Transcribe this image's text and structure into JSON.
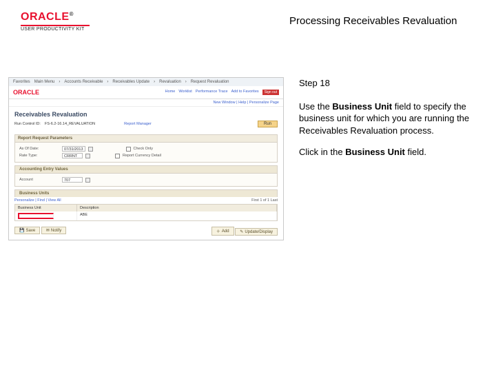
{
  "header": {
    "brand": "ORACLE",
    "subbrand": "USER PRODUCTIVITY KIT",
    "page_title": "Processing Receivables Revaluation"
  },
  "instructions": {
    "step_label": "Step 18",
    "p1_a": "Use the ",
    "p1_b": "Business Unit",
    "p1_c": " field to specify the business unit for which you are running the Receivables Revaluation process.",
    "p2_a": "Click in the ",
    "p2_b": "Business Unit",
    "p2_c": " field."
  },
  "app": {
    "breadcrumb": [
      "Favorites",
      "Main Menu",
      "Accounts Receivable",
      "Receivables Update",
      "Revaluation",
      "Request Revaluation"
    ],
    "brand": "ORACLE",
    "nav": [
      "Home",
      "Worklist",
      "Performance Trace",
      "Add to Favorites"
    ],
    "signout": "Sign out",
    "subnav": "New Window | Help | Personalize Page",
    "title": "Receivables Revaluation",
    "run_label": "Run Control ID:",
    "run_value": "FS-6.2-16.14_REVALUATION",
    "report_label": "Report Manager",
    "run_btn": "Run",
    "box1_title": "Report Request Parameters",
    "asof_label": "As Of Date:",
    "asof_value": "07/31/2013",
    "rate_label": "Rate Type:",
    "rate_value": "CRRNT",
    "chk_label": "Check Only",
    "rpt_label": "Report Currency Detail",
    "sec_title": "Accounting Entry Values",
    "acct_label": "Account",
    "acct_value": "707",
    "bu_title": "Business Units",
    "sub_links": "Personalize | Find | View All",
    "sub_meta": "First  1 of 1  Last",
    "th1": "Business Unit",
    "th2": "Description",
    "td_desc": "ABE",
    "save": "Save",
    "notify": "Notify",
    "add": "Add",
    "update": "Update/Display"
  }
}
